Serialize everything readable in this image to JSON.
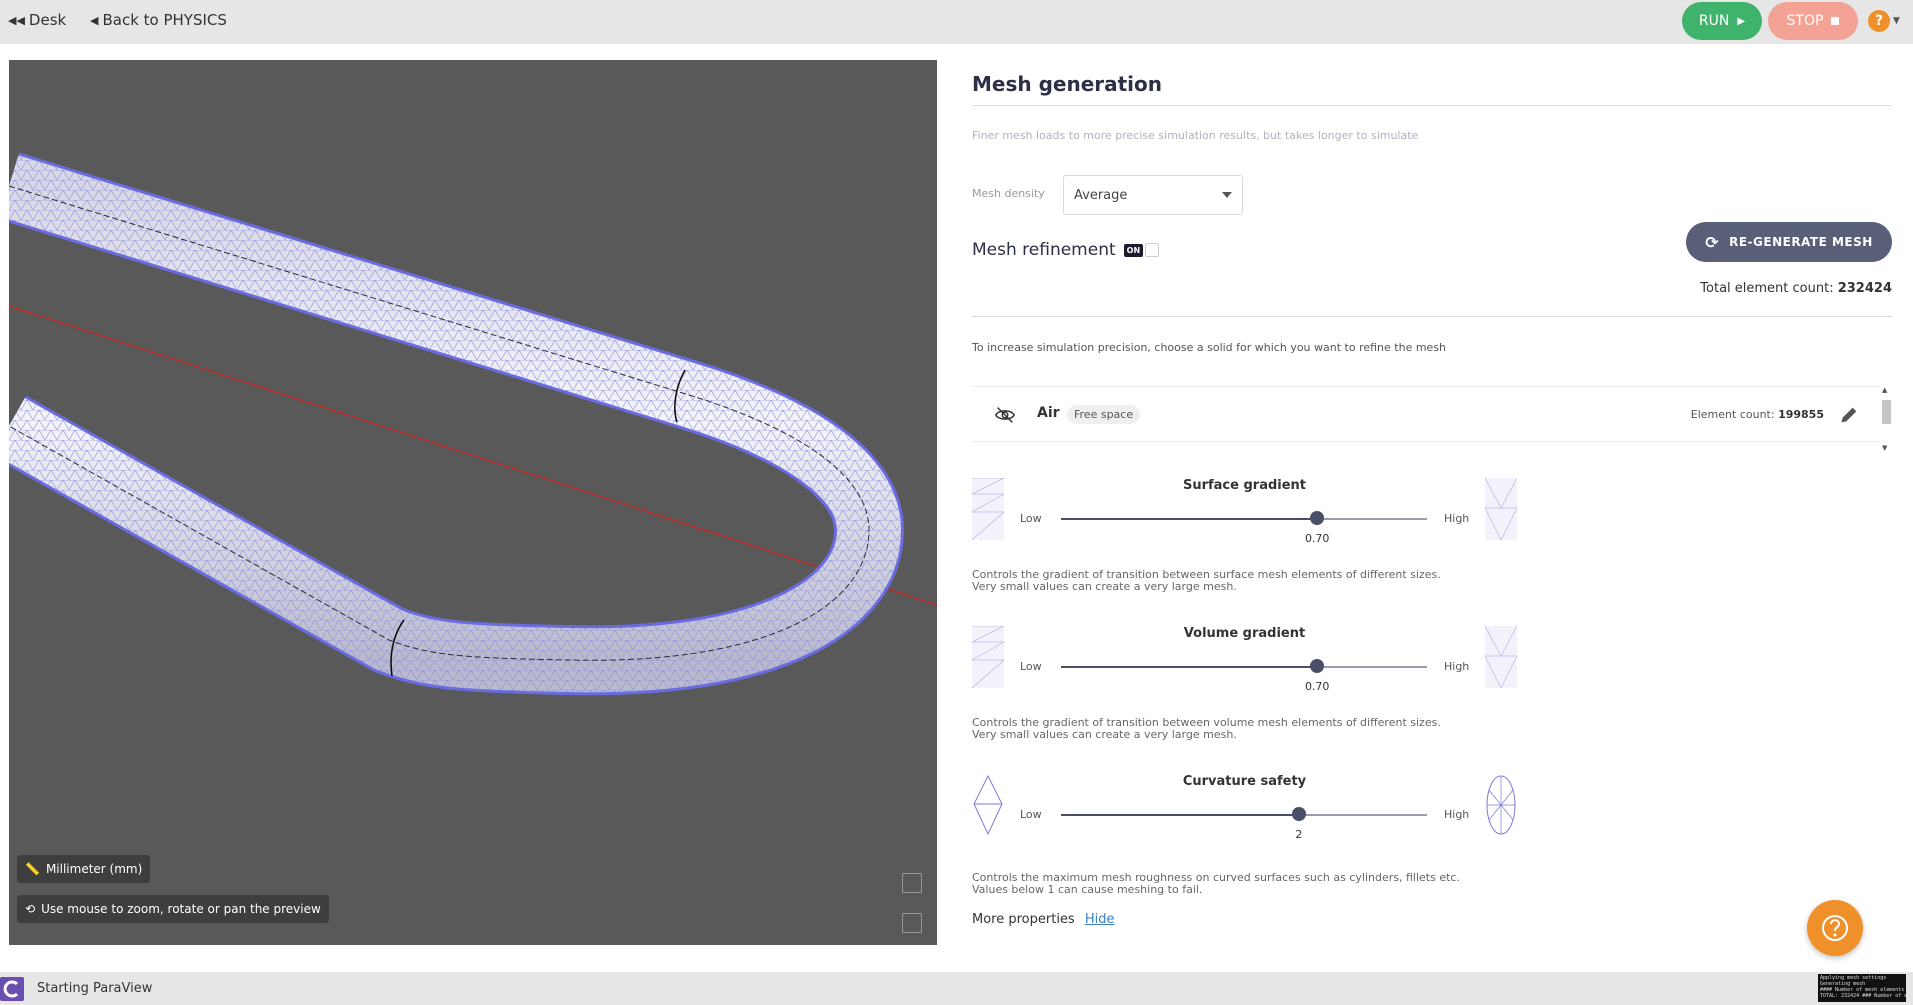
{
  "topbar": {
    "desk_label": "Desk",
    "back_label": "Back to PHYSICS",
    "run_label": "RUN",
    "stop_label": "STOP",
    "help_label": "?"
  },
  "viewport": {
    "units_label": "Millimeter (mm)",
    "hint_label": "Use mouse to zoom, rotate or pan the preview"
  },
  "mesh": {
    "title": "Mesh generation",
    "subtitle": "Finer mesh loads to more precise simulation results, but takes longer to simulate",
    "density_label": "Mesh density",
    "density_value": "Average",
    "refinement_title": "Mesh refinement",
    "refinement_toggle": "ON",
    "regen_label": "RE-GENERATE MESH",
    "total_label": "Total element count:",
    "total_value": "232424",
    "refine_hint": "To increase simulation precision, choose a solid for which you want to refine the mesh"
  },
  "solid": {
    "name": "Air",
    "badge": "Free space",
    "count_label": "Element count:",
    "count_value": "199855"
  },
  "sliders": [
    {
      "title": "Surface gradient",
      "low": "Low",
      "high": "High",
      "value": "0.70",
      "position": 0.7,
      "desc1": "Controls the gradient of transition between surface mesh elements of different sizes.",
      "desc2": "Very small values can create a very large mesh."
    },
    {
      "title": "Volume gradient",
      "low": "Low",
      "high": "High",
      "value": "0.70",
      "position": 0.7,
      "desc1": "Controls the gradient of transition between volume mesh elements of different sizes.",
      "desc2": "Very small values can create a very large mesh."
    },
    {
      "title": "Curvature safety",
      "low": "Low",
      "high": "High",
      "value": "2",
      "position": 0.65,
      "desc1": "Controls the maximum mesh roughness on curved surfaces such as cylinders, fillets etc.",
      "desc2": "Values below 1 can cause meshing to fail."
    }
  ],
  "more": {
    "label": "More properties",
    "link": "Hide"
  },
  "status": {
    "text": "Starting ParaView",
    "console": "Applying mesh settings\nGenerating mesh\n#### Number of mesh elements\nTOTAL: 232424 ### Number of e"
  },
  "colors": {
    "run": "#3fb36b",
    "stop": "#f4a196",
    "accent": "#f0902a",
    "viewport_bg": "#595959",
    "mesh_line": "#7b7bdc"
  }
}
